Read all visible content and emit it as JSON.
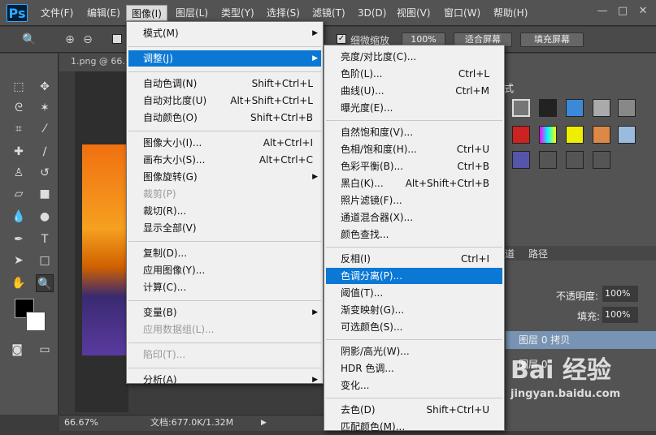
{
  "app": {
    "logo": "Ps"
  },
  "menubar": {
    "items": [
      "文件(F)",
      "编辑(E)",
      "图像(I)",
      "图层(L)",
      "类型(Y)",
      "选择(S)",
      "滤镜(T)",
      "3D(D)",
      "视图(V)",
      "窗口(W)",
      "帮助(H)"
    ],
    "active": "图像(I)",
    "window_controls": [
      "—",
      "□",
      "✕"
    ]
  },
  "options_bar": {
    "checkbox_label": "细微缩放",
    "checkbox_checked": true,
    "zoom_value": "100%",
    "fit_screen": "适合屏幕",
    "fill_screen": "填充屏幕"
  },
  "document": {
    "tab_label": "1.png @ 66.",
    "zoom": "66.67%",
    "doc_info": "文档:677.0K/1.32M"
  },
  "right_panel": {
    "styles_tab": "式",
    "channels_tab": "道",
    "paths_tab": "路径",
    "opacity_label": "不透明度:",
    "opacity_value": "100%",
    "fill_label": "填充:",
    "fill_value": "100%",
    "layers": [
      "图层 0 拷贝",
      "图层 0"
    ]
  },
  "image_menu": {
    "items": [
      {
        "label": "模式(M)",
        "shortcut": "",
        "submenu": true,
        "disabled": false
      },
      {
        "sep": true
      },
      {
        "label": "调整(J)",
        "shortcut": "",
        "submenu": true,
        "disabled": false,
        "highlight": true
      },
      {
        "sep": true
      },
      {
        "label": "自动色调(N)",
        "shortcut": "Shift+Ctrl+L"
      },
      {
        "label": "自动对比度(U)",
        "shortcut": "Alt+Shift+Ctrl+L"
      },
      {
        "label": "自动颜色(O)",
        "shortcut": "Shift+Ctrl+B"
      },
      {
        "sep": true
      },
      {
        "label": "图像大小(I)...",
        "shortcut": "Alt+Ctrl+I"
      },
      {
        "label": "画布大小(S)...",
        "shortcut": "Alt+Ctrl+C"
      },
      {
        "label": "图像旋转(G)",
        "shortcut": "",
        "submenu": true
      },
      {
        "label": "裁剪(P)",
        "shortcut": "",
        "disabled": true
      },
      {
        "label": "裁切(R)...",
        "shortcut": ""
      },
      {
        "label": "显示全部(V)",
        "shortcut": ""
      },
      {
        "sep": true
      },
      {
        "label": "复制(D)...",
        "shortcut": ""
      },
      {
        "label": "应用图像(Y)...",
        "shortcut": ""
      },
      {
        "label": "计算(C)...",
        "shortcut": ""
      },
      {
        "sep": true
      },
      {
        "label": "变量(B)",
        "shortcut": "",
        "submenu": true
      },
      {
        "label": "应用数据组(L)...",
        "shortcut": "",
        "disabled": true
      },
      {
        "sep": true
      },
      {
        "label": "陷印(T)...",
        "shortcut": "",
        "disabled": true
      },
      {
        "sep": true
      },
      {
        "label": "分析(A)",
        "shortcut": "",
        "submenu": true
      }
    ]
  },
  "adjust_menu": {
    "items": [
      {
        "label": "亮度/对比度(C)...",
        "shortcut": ""
      },
      {
        "label": "色阶(L)...",
        "shortcut": "Ctrl+L"
      },
      {
        "label": "曲线(U)...",
        "shortcut": "Ctrl+M"
      },
      {
        "label": "曝光度(E)...",
        "shortcut": ""
      },
      {
        "sep": true
      },
      {
        "label": "自然饱和度(V)...",
        "shortcut": ""
      },
      {
        "label": "色相/饱和度(H)...",
        "shortcut": "Ctrl+U"
      },
      {
        "label": "色彩平衡(B)...",
        "shortcut": "Ctrl+B"
      },
      {
        "label": "黑白(K)...",
        "shortcut": "Alt+Shift+Ctrl+B"
      },
      {
        "label": "照片滤镜(F)...",
        "shortcut": ""
      },
      {
        "label": "通道混合器(X)...",
        "shortcut": ""
      },
      {
        "label": "颜色查找...",
        "shortcut": ""
      },
      {
        "sep": true
      },
      {
        "label": "反相(I)",
        "shortcut": "Ctrl+I"
      },
      {
        "label": "色调分离(P)...",
        "shortcut": "",
        "highlight": true
      },
      {
        "label": "阈值(T)...",
        "shortcut": ""
      },
      {
        "label": "渐变映射(G)...",
        "shortcut": ""
      },
      {
        "label": "可选颜色(S)...",
        "shortcut": ""
      },
      {
        "sep": true
      },
      {
        "label": "阴影/高光(W)...",
        "shortcut": ""
      },
      {
        "label": "HDR 色调...",
        "shortcut": ""
      },
      {
        "label": "变化...",
        "shortcut": ""
      },
      {
        "sep": true
      },
      {
        "label": "去色(D)",
        "shortcut": "Shift+Ctrl+U"
      },
      {
        "label": "匹配颜色(M)...",
        "shortcut": ""
      }
    ]
  },
  "watermark": {
    "text": "Bai 经验",
    "url": "jingyan.baidu.com"
  },
  "colors": {
    "highlight": "#0a78d4",
    "menu_bg": "#f0f0f0",
    "panel": "#535353"
  }
}
